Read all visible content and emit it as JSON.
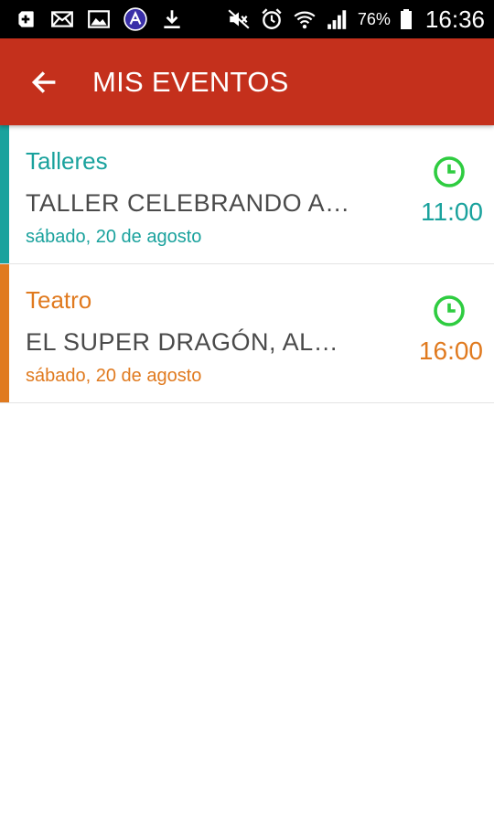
{
  "status_bar": {
    "battery": "76%",
    "time": "16:36",
    "icons": [
      "add-box-icon",
      "mail-icon",
      "image-icon",
      "app-badge-icon",
      "download-icon",
      "mute-icon",
      "alarm-icon",
      "wifi-icon",
      "signal-icon",
      "battery-icon"
    ]
  },
  "header": {
    "title": "MIS EVENTOS",
    "color": "#c4301c"
  },
  "events": [
    {
      "category": "Talleres",
      "title": "TALLER CELEBRANDO A…",
      "date": "sábado, 20 de agosto",
      "time": "11:00",
      "color": "#1aa29d"
    },
    {
      "category": "Teatro",
      "title": "EL SUPER DRAGÓN, AL…",
      "date": "sábado, 20 de agosto",
      "time": "16:00",
      "color": "#e07a1f"
    }
  ],
  "colors": {
    "clock_icon": "#2ecc40"
  }
}
